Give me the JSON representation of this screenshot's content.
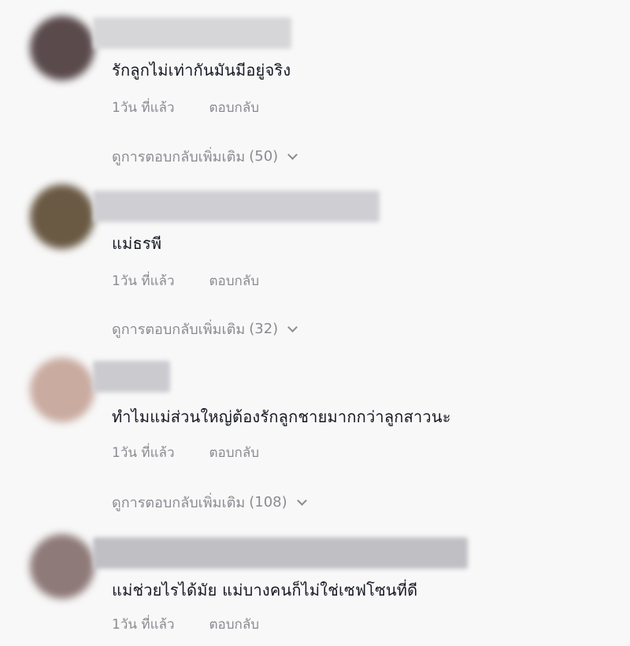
{
  "comments": [
    {
      "text": "รักลูกไม่เท่ากันมันมีอยู่จริง",
      "time": "1วัน ที่แล้ว",
      "reply_label": "ตอบกลับ",
      "more_replies": {
        "label": "ดูการตอบกลับเพิ่มเติม",
        "count": "(50)"
      },
      "avatar_color": "#5a4a4c",
      "username_color": "#d6d6d9"
    },
    {
      "text": "แม่ธรพี",
      "time": "1วัน ที่แล้ว",
      "reply_label": "ตอบกลับ",
      "more_replies": {
        "label": "ดูการตอบกลับเพิ่มเติม",
        "count": "(32)"
      },
      "avatar_color": "#6a5a44",
      "username_color": "#cfcfd3"
    },
    {
      "text": "ทำไมแม่ส่วนใหญ่ต้องรักลูกชายมากกว่าลูกสาวนะ",
      "time": "1วัน ที่แล้ว",
      "reply_label": "ตอบกลับ",
      "more_replies": {
        "label": "ดูการตอบกลับเพิ่มเติม",
        "count": "(108)"
      },
      "avatar_color": "#c9aba0",
      "username_color": "#cbcbcf"
    },
    {
      "text": "แม่ช่วยไรได้มัย แม่บางคนก็ไม่ใช่เซฟโซนที่ดี",
      "time": "1วัน ที่แล้ว",
      "reply_label": "ตอบกลับ",
      "avatar_color": "#8e7a78",
      "username_color": "#bfbfc4"
    }
  ]
}
